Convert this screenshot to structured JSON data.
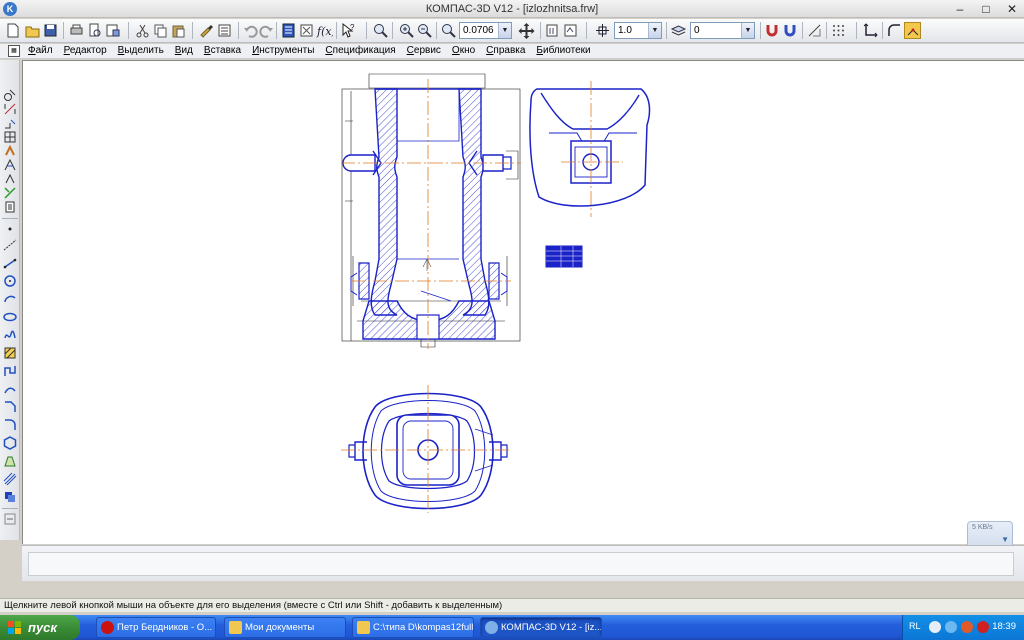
{
  "window": {
    "title": "КОМПАС-3D V12 - [izlozhnitsa.frw]",
    "app_icon": "kompas-icon"
  },
  "toolbar": {
    "scale_value": "0.0706",
    "step_value": "1.0",
    "layer_value": "0"
  },
  "menu": {
    "items": [
      "Файл",
      "Редактор",
      "Выделить",
      "Вид",
      "Вставка",
      "Инструменты",
      "Спецификация",
      "Сервис",
      "Окно",
      "Справка",
      "Библиотеки"
    ]
  },
  "canvas": {
    "side_badge": "5 KB/s",
    "colors": {
      "outline": "#1a22c8",
      "axis": "#e07a20",
      "hatch": "#1a22c8"
    }
  },
  "status": {
    "message": "Щелкните левой кнопкой мыши на объекте для его выделения (вместе с Ctrl или Shift - добавить к выделенным)"
  },
  "taskbar": {
    "start_label": "пуск",
    "items": [
      {
        "label": "Петр Бердников - О...",
        "icon": "opera-icon"
      },
      {
        "label": "Мои документы",
        "icon": "folder-icon"
      },
      {
        "label": "C:\\типа D\\kompas12full",
        "icon": "folder-icon"
      },
      {
        "label": "КОМПАС-3D V12 - [iz...",
        "icon": "kompas-icon"
      }
    ],
    "tray": {
      "lang": "RL",
      "clock": "18:39"
    }
  }
}
